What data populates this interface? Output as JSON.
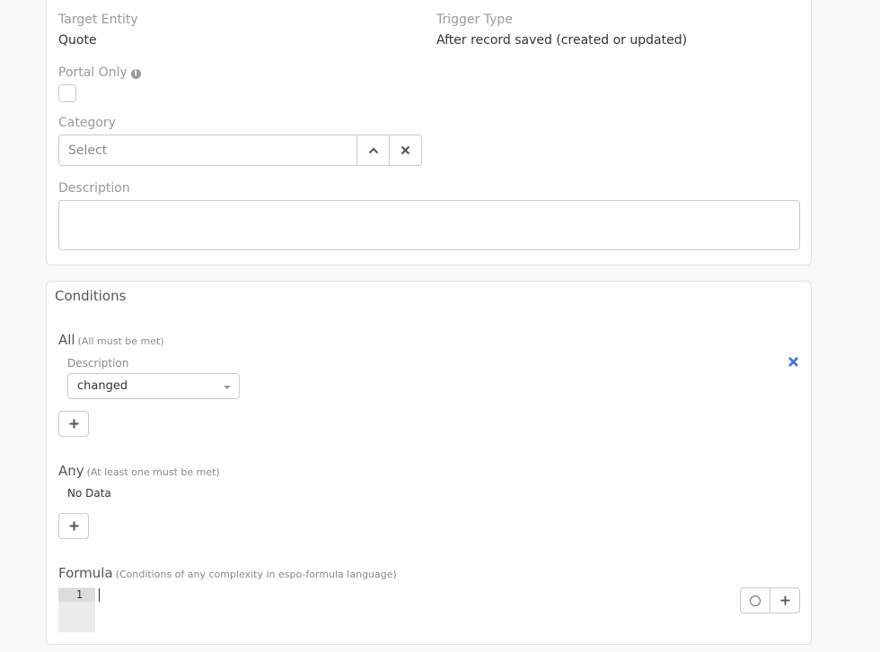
{
  "details": {
    "target_entity_label": "Target Entity",
    "target_entity_value": "Quote",
    "trigger_type_label": "Trigger Type",
    "trigger_type_value": "After record saved (created or updated)",
    "portal_only_label": "Portal Only",
    "portal_only_checked": false,
    "category_label": "Category",
    "category_placeholder": "Select",
    "description_label": "Description",
    "description_value": ""
  },
  "conditions": {
    "title": "Conditions",
    "all": {
      "title": "All",
      "subtitle": "(All must be met)",
      "items": [
        {
          "field_label": "Description",
          "operator": "changed"
        }
      ]
    },
    "any": {
      "title": "Any",
      "subtitle": "(At least one must be met)",
      "empty_text": "No Data"
    },
    "formula": {
      "title": "Formula",
      "subtitle": "(Conditions of any complexity in espo-formula language)",
      "line_number": "1"
    }
  },
  "icons": {
    "info": "info-icon",
    "chevron_up": "chevron-up-icon",
    "close": "close-icon",
    "plus": "plus-icon",
    "remove": "remove-icon",
    "circle": "circle-icon"
  },
  "colors": {
    "accent": "#3d7bd9",
    "label": "#999999",
    "border": "#cccccc"
  }
}
